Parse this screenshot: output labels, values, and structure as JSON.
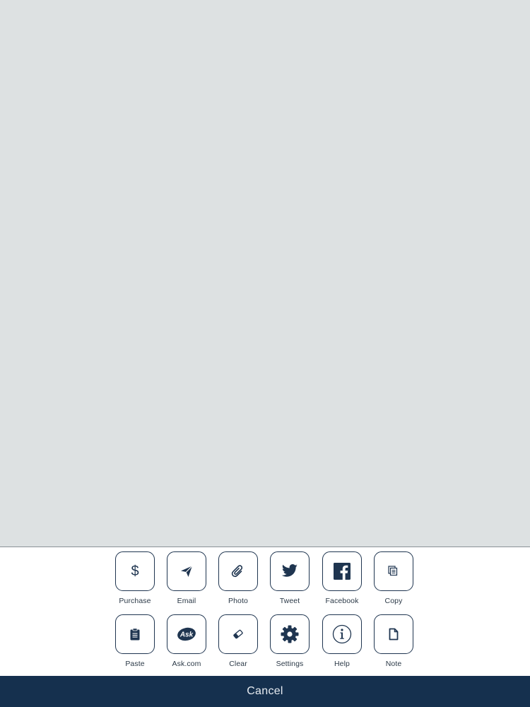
{
  "actions_row_1": [
    {
      "label": "Purchase",
      "icon": "dollar-icon"
    },
    {
      "label": "Email",
      "icon": "paper-plane-icon"
    },
    {
      "label": "Photo",
      "icon": "paperclip-icon"
    },
    {
      "label": "Tweet",
      "icon": "twitter-bird-icon"
    },
    {
      "label": "Facebook",
      "icon": "facebook-icon"
    },
    {
      "label": "Copy",
      "icon": "copy-icon"
    }
  ],
  "actions_row_2": [
    {
      "label": "Paste",
      "icon": "clipboard-icon"
    },
    {
      "label": "Ask.com",
      "icon": "ask-logo-icon"
    },
    {
      "label": "Clear",
      "icon": "eraser-icon"
    },
    {
      "label": "Settings",
      "icon": "gear-icon"
    },
    {
      "label": "Help",
      "icon": "info-icon"
    },
    {
      "label": "Note",
      "icon": "document-icon"
    }
  ],
  "purchase_icon_text": "$",
  "ask_logo_text": "Ask",
  "cancel_label": "Cancel",
  "colors": {
    "canvas_background": "#dde1e2",
    "icon_navy": "#1f3550",
    "cancel_bar": "#15304e"
  }
}
